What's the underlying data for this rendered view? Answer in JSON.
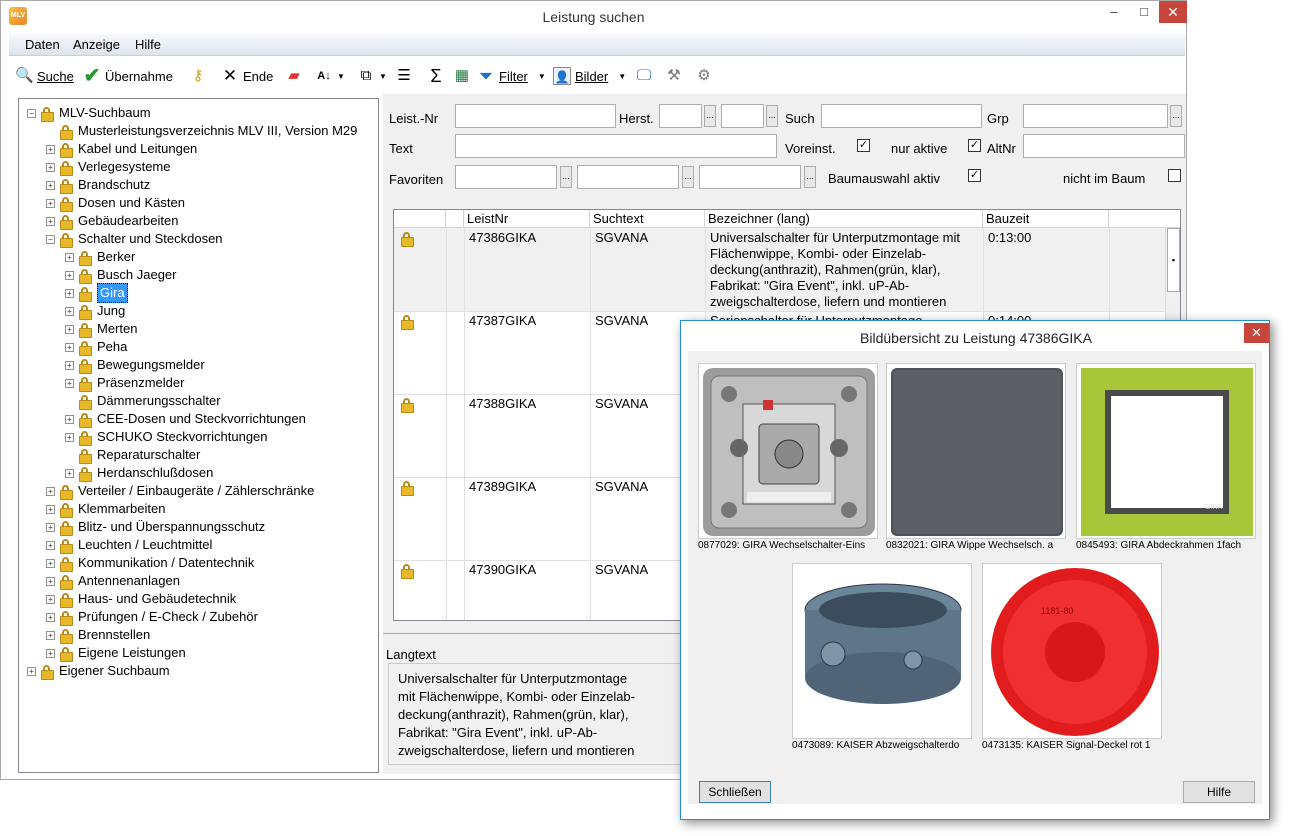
{
  "window": {
    "title": "Leistung suchen",
    "logo": "MLV"
  },
  "menu": [
    "Daten",
    "Anzeige",
    "Hilfe"
  ],
  "toolbar": {
    "suche": "Suche",
    "uebernahme": "Übernahme",
    "ende": "Ende",
    "filter": "Filter",
    "bilder": "Bilder"
  },
  "tree": {
    "root": "MLV-Suchbaum",
    "items": [
      "Musterleistungsverzeichnis MLV III, Version M29",
      "Kabel und Leitungen",
      "Verlegesysteme",
      "Brandschutz",
      "Dosen und Kästen",
      "Gebäudearbeiten",
      "Schalter und Steckdosen"
    ],
    "sub": [
      "Berker",
      "Busch Jaeger",
      "Gira",
      "Jung",
      "Merten",
      "Peha",
      "Bewegungsmelder",
      "Präsenzmelder",
      "Dämmerungsschalter",
      "CEE-Dosen und Steckvorrichtungen",
      "SCHUKO Steckvorrichtungen",
      "Reparaturschalter",
      "Herdanschlußdosen"
    ],
    "items2": [
      "Verteiler / Einbaugeräte / Zählerschränke",
      "Klemmarbeiten",
      "Blitz- und Überspannungsschutz",
      "Leuchten / Leuchtmittel",
      "Kommunikation / Datentechnik",
      "Antennenanlagen",
      "Haus- und Gebäudetechnik",
      "Prüfungen / E-Check / Zubehör",
      "Brennstellen",
      "Eigene Leistungen"
    ],
    "root2": "Eigener Suchbaum"
  },
  "form": {
    "leistnr": "Leist.-Nr",
    "herst": "Herst.",
    "such": "Such",
    "grp": "Grp",
    "text": "Text",
    "voreinst": "Voreinst.",
    "nuraktive": "nur aktive",
    "altnr": "AltNr",
    "favoriten": "Favoriten",
    "baumauswahl": "Baumauswahl aktiv",
    "nichtimbaum": "nicht im Baum",
    "dots": "..."
  },
  "grid": {
    "headers": [
      "LeistNr",
      "Suchtext",
      "Bezeichner (lang)",
      "Bauzeit"
    ],
    "rows": [
      {
        "nr": "47386GIKA",
        "such": "SGVANA",
        "bez": "Universalschalter für Unterputzmontage mit Flächenwippe, Kombi- oder Einzelab- deckung(anthrazit), Rahmen(grün, klar), Fabrikat: \"Gira Event\", inkl. uP-Ab- zweigschalterdose, liefern und montieren",
        "zeit": "0:13:00"
      },
      {
        "nr": "47387GIKA",
        "such": "SGVANA",
        "bez": "Serienschalter für Unterputzmontage",
        "zeit": "0:14:00"
      },
      {
        "nr": "47388GIKA",
        "such": "SGVANA",
        "bez": "",
        "zeit": ""
      },
      {
        "nr": "47389GIKA",
        "such": "SGVANA",
        "bez": "",
        "zeit": ""
      },
      {
        "nr": "47390GIKA",
        "such": "SGVANA",
        "bez": "",
        "zeit": ""
      }
    ]
  },
  "langtext": {
    "title": "Langtext",
    "lines": [
      "Universalschalter für Unterputzmontage",
      "mit Flächenwippe, Kombi- oder Einzelab-",
      "deckung(anthrazit), Rahmen(grün, klar),",
      "Fabrikat: \"Gira Event\", inkl. uP-Ab-",
      "zweigschalterdose, liefern und montieren"
    ]
  },
  "dialog": {
    "title": "Bildübersicht zu Leistung 47386GIKA",
    "images": [
      "0877029: GIRA Wechselschalter-Eins",
      "0832021: GIRA Wippe Wechselsch. a",
      "0845493: GIRA Abdeckrahmen 1fach",
      "0473089: KAISER Abzweigschalterdo",
      "0473135: KAISER Signal-Deckel rot 1"
    ],
    "close": "Schließen",
    "help": "Hilfe",
    "stamp": "1181-80"
  }
}
